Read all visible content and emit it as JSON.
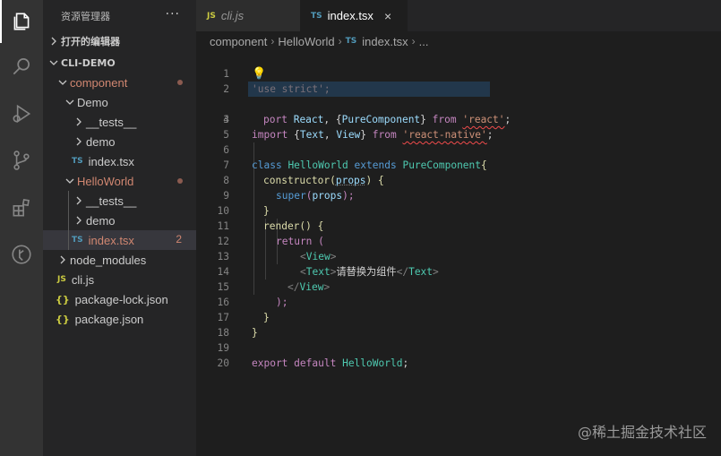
{
  "activity_bar": {
    "items": [
      {
        "icon": "files-icon"
      },
      {
        "icon": "search-icon"
      },
      {
        "icon": "debug-icon"
      },
      {
        "icon": "source-control-icon"
      },
      {
        "icon": "extensions-icon"
      },
      {
        "icon": "remote-icon"
      }
    ]
  },
  "sidebar": {
    "title": "资源管理器",
    "more": "···",
    "open_editors": "打开的编辑器",
    "project": "CLI-DEMO",
    "items": [
      {
        "label": "component"
      },
      {
        "label": "Demo"
      },
      {
        "label": "__tests__"
      },
      {
        "label": "demo"
      },
      {
        "label": "index.tsx",
        "type": "TS"
      },
      {
        "label": "HelloWorld"
      },
      {
        "label": "__tests__"
      },
      {
        "label": "demo"
      },
      {
        "label": "index.tsx",
        "type": "TS",
        "count": "2"
      },
      {
        "label": "node_modules"
      },
      {
        "label": "cli.js",
        "type": "JS"
      },
      {
        "label": "package-lock.json",
        "type": "{}"
      },
      {
        "label": "package.json",
        "type": "{}"
      }
    ]
  },
  "tabs": [
    {
      "label": "cli.js",
      "type": "JS"
    },
    {
      "label": "index.tsx",
      "type": "TS",
      "close": "×"
    }
  ],
  "breadcrumb": {
    "parts": [
      "component",
      "HelloWorld",
      "index.tsx",
      "..."
    ],
    "file_type": "TS"
  },
  "editor": {
    "line_numbers": [
      "1",
      "2",
      "3",
      "4",
      "5",
      "6",
      "7",
      "8",
      "9",
      "10",
      "11",
      "12",
      "13",
      "14",
      "15",
      "16",
      "17",
      "18",
      "19",
      "20"
    ],
    "tokens": {
      "l1_str": "'use strict';",
      "l2_import_tail": "port",
      "l2_react": "React",
      "l2_mid": ", {",
      "l2_pure": "PureComponent",
      "l2_end": "} ",
      "l2_from": "from",
      "l2_src": "'react'",
      "l2_semi": ";",
      "l3_import": "import",
      "l3_open": " {",
      "l3_text": "Text",
      "l3_comma": ", ",
      "l3_view": "View",
      "l3_close": "} ",
      "l3_from": "from",
      "l3_src": "'react-native'",
      "l3_semi": ";",
      "l6_class": "class",
      "l6_name": "HelloWorld",
      "l6_extends": "extends",
      "l6_base": "PureComponent",
      "l6_brace": "{",
      "l7_ctor": "constructor",
      "l7_paren": "(",
      "l7_props": "props",
      "l7_end": ") {",
      "l8_super": "super",
      "l8_paren": "(",
      "l8_props": "props",
      "l8_end": ");",
      "l9": "}",
      "l10_render": "render",
      "l10_end": "() {",
      "l11_return": "return",
      "l11_paren": " (",
      "l12_open": "<",
      "l12_tag": "View",
      "l12_close": ">",
      "l13_open": "<",
      "l13_tag": "Text",
      "l13_gt": ">",
      "l13_text": "请替换为组件",
      "l13_endopen": "</",
      "l13_endtag": "Text",
      "l13_endgt": ">",
      "l14_open": "</",
      "l14_tag": "View",
      "l14_close": ">",
      "l15": ");",
      "l16": "}",
      "l17": "}",
      "l19_export": "export",
      "l19_default": "default",
      "l19_name": "HelloWorld",
      "l19_semi": ";"
    }
  },
  "watermark": "@稀土掘金技术社区",
  "colors": {
    "activity_bar": "#333333",
    "sidebar": "#252526",
    "editor": "#1e1e1e",
    "modified": "#d18771",
    "ts_icon": "#519aba",
    "js_icon": "#cbcb41"
  }
}
